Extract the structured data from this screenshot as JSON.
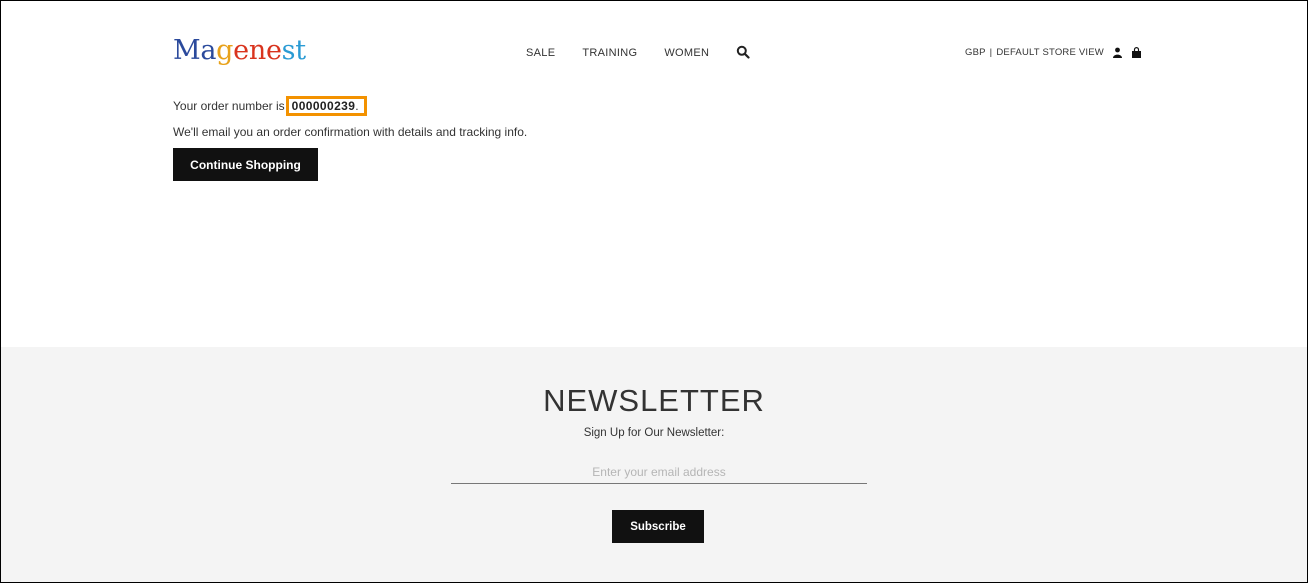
{
  "header": {
    "logo_letters": [
      {
        "ch": "M",
        "color": "#2b4a9c"
      },
      {
        "ch": "a",
        "color": "#2b4a9c"
      },
      {
        "ch": "g",
        "color": "#e8a21b"
      },
      {
        "ch": "e",
        "color": "#d9341e"
      },
      {
        "ch": "n",
        "color": "#d9341e"
      },
      {
        "ch": "e",
        "color": "#d9341e"
      },
      {
        "ch": "s",
        "color": "#2a9bd4"
      },
      {
        "ch": "t",
        "color": "#2a9bd4"
      }
    ],
    "logo_text": "Magenest",
    "nav": [
      {
        "label": "SALE"
      },
      {
        "label": "TRAINING"
      },
      {
        "label": "WOMEN"
      }
    ],
    "search_icon": "search-icon",
    "currency": "GBP",
    "separator": "|",
    "store_view": "DEFAULT STORE VIEW",
    "account_icon": "user-icon",
    "cart_icon": "shopping-bag-icon"
  },
  "success": {
    "order_prefix": "Your order number is",
    "order_number": "000000239",
    "order_suffix": ".",
    "confirmation": "We'll email you an order confirmation with details and tracking info.",
    "continue_label": "Continue Shopping",
    "highlight_color": "#f39200"
  },
  "newsletter": {
    "title": "NEWSLETTER",
    "subtitle": "Sign Up for Our Newsletter:",
    "email_placeholder": "Enter your email address",
    "email_value": "",
    "subscribe_label": "Subscribe"
  }
}
